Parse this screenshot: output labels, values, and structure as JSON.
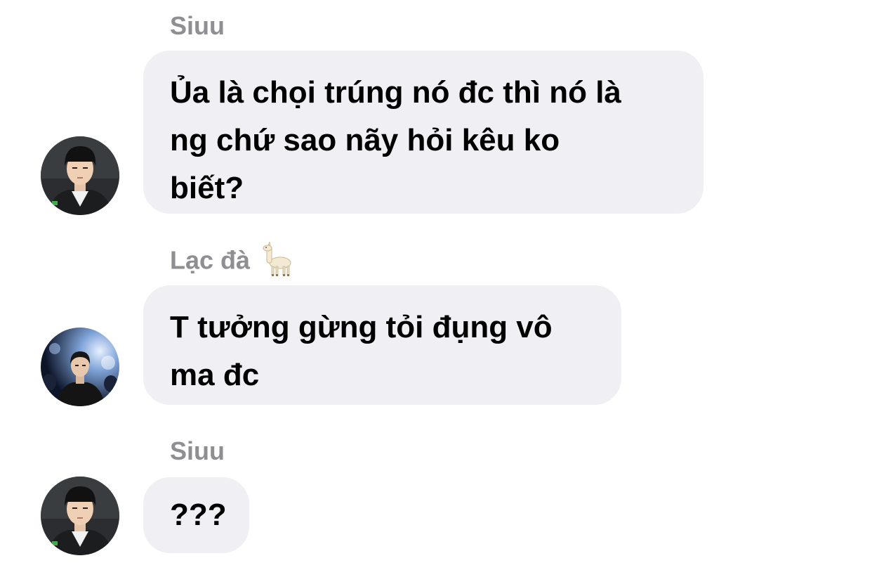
{
  "messages": [
    {
      "sender": "Siuu",
      "text_lines": [
        "Ủa là chọi trúng nó đc thì nó là",
        "ng chứ sao nãy hỏi kêu ko",
        "biết?"
      ],
      "avatar": "avatar-man-dark-jacket"
    },
    {
      "sender": "Lạc đà",
      "sender_emoji": "llama-icon",
      "text_lines": [
        "T tưởng gừng tỏi đụng vô",
        "ma đc"
      ],
      "avatar": "avatar-man-stage-lights"
    },
    {
      "sender": "Siuu",
      "text_lines": [
        "???"
      ],
      "avatar": "avatar-man-dark-jacket"
    }
  ],
  "colors": {
    "background": "#ffffff",
    "bubble": "#efeff4",
    "sender_name": "#8e8e93",
    "message_text": "#000000"
  }
}
